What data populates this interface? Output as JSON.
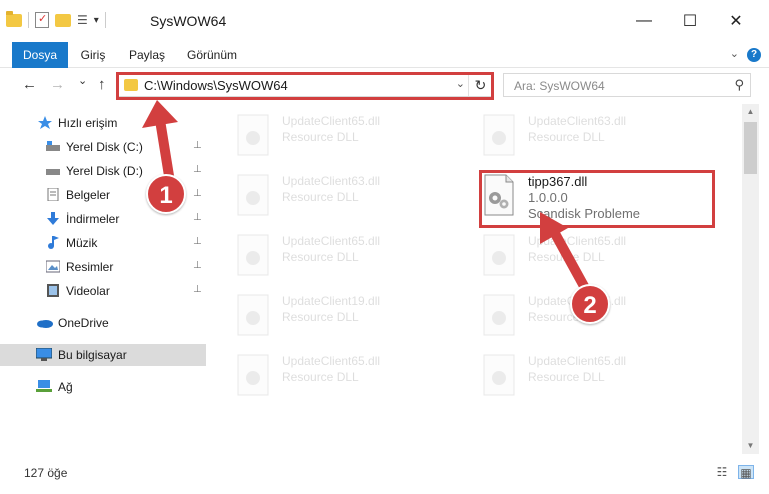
{
  "window": {
    "title": "SysWOW64",
    "minimize_glyph": "—",
    "maximize_glyph": "☐",
    "close_glyph": "✕"
  },
  "qat": {
    "dropdown_glyph": "▾",
    "icons": [
      "folder-icon",
      "properties-icon",
      "new-folder-icon"
    ]
  },
  "ribbon": {
    "tabs": [
      {
        "label": "Dosya",
        "active": true
      },
      {
        "label": "Giriş",
        "active": false
      },
      {
        "label": "Paylaş",
        "active": false
      },
      {
        "label": "Görünüm",
        "active": false
      }
    ],
    "expand_glyph": "⌄",
    "help_glyph": "?"
  },
  "nav": {
    "back_glyph": "←",
    "forward_glyph": "→",
    "recent_glyph": "⌄",
    "up_glyph": "↑",
    "address": "C:\\Windows\\SysWOW64",
    "address_drop_glyph": "⌄",
    "refresh_glyph": "↻",
    "search_placeholder": "Ara: SysWOW64",
    "search_glyph": "⚲"
  },
  "sidebar": {
    "items": [
      {
        "label": "Hızlı erişim",
        "icon": "star-icon",
        "pinned": false,
        "selected": false
      },
      {
        "label": "Yerel Disk (C:)",
        "icon": "drive-c-icon",
        "pinned": true,
        "selected": false
      },
      {
        "label": "Yerel Disk (D:)",
        "icon": "drive-d-icon",
        "pinned": true,
        "selected": false
      },
      {
        "label": "Belgeler",
        "icon": "documents-icon",
        "pinned": true,
        "selected": false
      },
      {
        "label": "İndirmeler",
        "icon": "downloads-icon",
        "pinned": true,
        "selected": false
      },
      {
        "label": "Müzik",
        "icon": "music-icon",
        "pinned": true,
        "selected": false
      },
      {
        "label": "Resimler",
        "icon": "pictures-icon",
        "pinned": true,
        "selected": false
      },
      {
        "label": "Videolar",
        "icon": "videos-icon",
        "pinned": true,
        "selected": false
      },
      {
        "label": "OneDrive",
        "icon": "onedrive-icon",
        "pinned": false,
        "selected": false
      },
      {
        "label": "Bu bilgisayar",
        "icon": "computer-icon",
        "pinned": false,
        "selected": true
      },
      {
        "label": "Ağ",
        "icon": "network-icon",
        "pinned": false,
        "selected": false
      }
    ],
    "pin_glyph": "📌"
  },
  "files": {
    "ghost": [
      {
        "name": "UpdateClient65.dll",
        "desc": "Resource DLL"
      },
      {
        "name": "UpdateClient63.dll",
        "desc": "Resource DLL"
      },
      {
        "name": "UpdateClient63.dll",
        "desc": "Resource DLL"
      },
      {
        "name": "UpdateClient65.dll",
        "desc": "Resource DLL"
      },
      {
        "name": "UpdateClient65.dll",
        "desc": "Resource DLL"
      },
      {
        "name": "UpdateClient19.dll",
        "desc": "Resource DLL"
      },
      {
        "name": "UpdateClient65.dll",
        "desc": "Resource DLL"
      },
      {
        "name": "UpdateClient65.dll",
        "desc": "Resource DLL"
      },
      {
        "name": "UpdateClient65.dll",
        "desc": "Resource DLL"
      }
    ],
    "highlight": {
      "name": "tipp367.dll",
      "version": "1.0.0.0",
      "description": "Scandisk Probleme"
    }
  },
  "status": {
    "item_count": "127 öğe",
    "details_view_glyph": "☷",
    "tiles_view_glyph": "▦"
  },
  "annotations": {
    "badge1": "1",
    "badge2": "2",
    "accent": "#d23f3f"
  },
  "colors": {
    "ribbon_accent": "#1979ca",
    "selected_bg": "#dbdbdb",
    "folder": "#f3c843"
  }
}
